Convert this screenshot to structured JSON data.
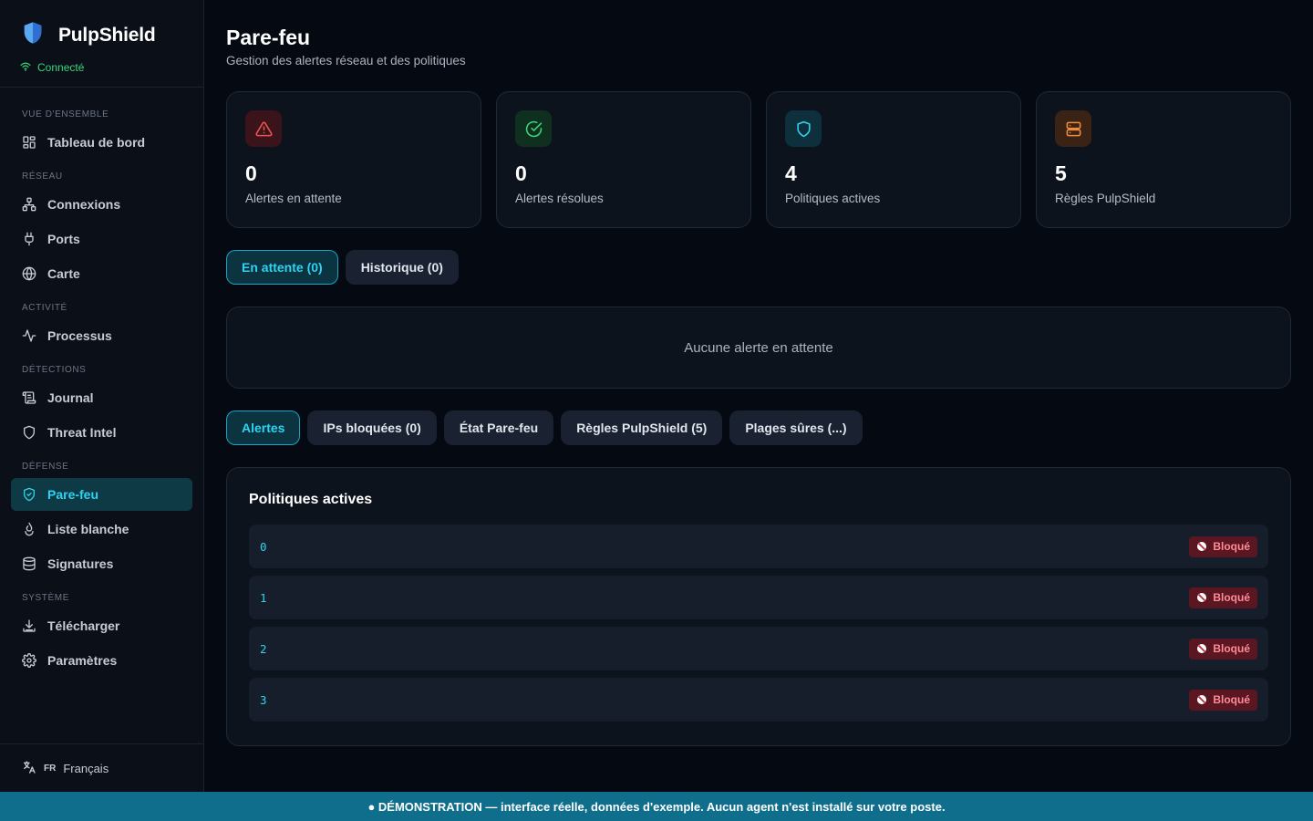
{
  "app": {
    "name": "PulpShield",
    "status": "Connecté"
  },
  "nav": {
    "sections": [
      {
        "title": "VUE D'ENSEMBLE",
        "items": [
          {
            "label": "Tableau de bord",
            "icon": "dashboard-icon"
          }
        ]
      },
      {
        "title": "RÉSEAU",
        "items": [
          {
            "label": "Connexions",
            "icon": "network-icon"
          },
          {
            "label": "Ports",
            "icon": "plug-icon"
          },
          {
            "label": "Carte",
            "icon": "globe-icon"
          }
        ]
      },
      {
        "title": "ACTIVITÉ",
        "items": [
          {
            "label": "Processus",
            "icon": "activity-icon"
          }
        ]
      },
      {
        "title": "DÉTECTIONS",
        "items": [
          {
            "label": "Journal",
            "icon": "scroll-icon"
          },
          {
            "label": "Threat Intel",
            "icon": "shield-icon"
          }
        ]
      },
      {
        "title": "DÉFENSE",
        "items": [
          {
            "label": "Pare-feu",
            "icon": "shield-check-icon",
            "active": true
          },
          {
            "label": "Liste blanche",
            "icon": "hand-icon"
          },
          {
            "label": "Signatures",
            "icon": "database-icon"
          }
        ]
      },
      {
        "title": "SYSTÈME",
        "items": [
          {
            "label": "Télécharger",
            "icon": "download-icon"
          },
          {
            "label": "Paramètres",
            "icon": "gear-icon"
          }
        ]
      }
    ]
  },
  "language": {
    "code": "FR",
    "label": "Français"
  },
  "page": {
    "title": "Pare-feu",
    "subtitle": "Gestion des alertes réseau et des politiques"
  },
  "stats": [
    {
      "value": "0",
      "label": "Alertes en attente",
      "icon": "alert-triangle-icon",
      "color": "#f05252"
    },
    {
      "value": "0",
      "label": "Alertes résolues",
      "icon": "check-circle-icon",
      "color": "#37d67a"
    },
    {
      "value": "4",
      "label": "Politiques actives",
      "icon": "shield-icon",
      "color": "#2fd3ef"
    },
    {
      "value": "5",
      "label": "Règles PulpShield",
      "icon": "server-icon",
      "color": "#f08a3c"
    }
  ],
  "alert_tabs": [
    {
      "label": "En attente (0)",
      "active": true
    },
    {
      "label": "Historique (0)",
      "active": false
    }
  ],
  "empty_state": "Aucune alerte en attente",
  "section_tabs": [
    {
      "label": "Alertes",
      "active": true
    },
    {
      "label": "IPs bloquées (0)",
      "active": false
    },
    {
      "label": "État Pare-feu",
      "active": false
    },
    {
      "label": "Règles PulpShield (5)",
      "active": false
    },
    {
      "label": "Plages sûres (...)",
      "active": false
    }
  ],
  "policies": {
    "title": "Politiques actives",
    "items": [
      {
        "id": "0",
        "status": "Bloqué"
      },
      {
        "id": "1",
        "status": "Bloqué"
      },
      {
        "id": "2",
        "status": "Bloqué"
      },
      {
        "id": "3",
        "status": "Bloqué"
      }
    ]
  },
  "banner": "● DÉMONSTRATION — interface réelle, données d'exemple. Aucun agent n'est installé sur votre poste."
}
